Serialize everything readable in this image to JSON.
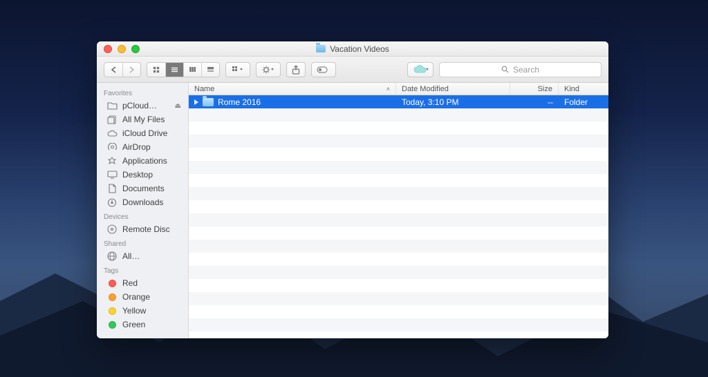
{
  "window": {
    "title": "Vacation Videos"
  },
  "toolbar": {},
  "search": {
    "placeholder": "Search"
  },
  "columns": {
    "name": "Name",
    "date": "Date Modified",
    "size": "Size",
    "kind": "Kind"
  },
  "sidebar": {
    "sections": [
      {
        "label": "Favorites",
        "items": [
          {
            "icon": "folder",
            "label": "pCloud…",
            "eject": true
          },
          {
            "icon": "allfiles",
            "label": "All My Files"
          },
          {
            "icon": "cloud",
            "label": "iCloud Drive"
          },
          {
            "icon": "airdrop",
            "label": "AirDrop"
          },
          {
            "icon": "apps",
            "label": "Applications"
          },
          {
            "icon": "desktop",
            "label": "Desktop"
          },
          {
            "icon": "docs",
            "label": "Documents"
          },
          {
            "icon": "downloads",
            "label": "Downloads"
          }
        ]
      },
      {
        "label": "Devices",
        "items": [
          {
            "icon": "disc",
            "label": "Remote Disc"
          }
        ]
      },
      {
        "label": "Shared",
        "items": [
          {
            "icon": "globe",
            "label": "All…"
          }
        ]
      },
      {
        "label": "Tags",
        "items": [
          {
            "icon": "tag",
            "label": "Red",
            "color": "#ff5b55"
          },
          {
            "icon": "tag",
            "label": "Orange",
            "color": "#ff9f2e"
          },
          {
            "icon": "tag",
            "label": "Yellow",
            "color": "#ffd32e"
          },
          {
            "icon": "tag",
            "label": "Green",
            "color": "#35c75a"
          }
        ]
      }
    ]
  },
  "rows": [
    {
      "name": "Rome 2016",
      "date": "Today, 3:10 PM",
      "size": "--",
      "kind": "Folder",
      "selected": true,
      "expandable": true
    }
  ],
  "empty_row_count": 19
}
